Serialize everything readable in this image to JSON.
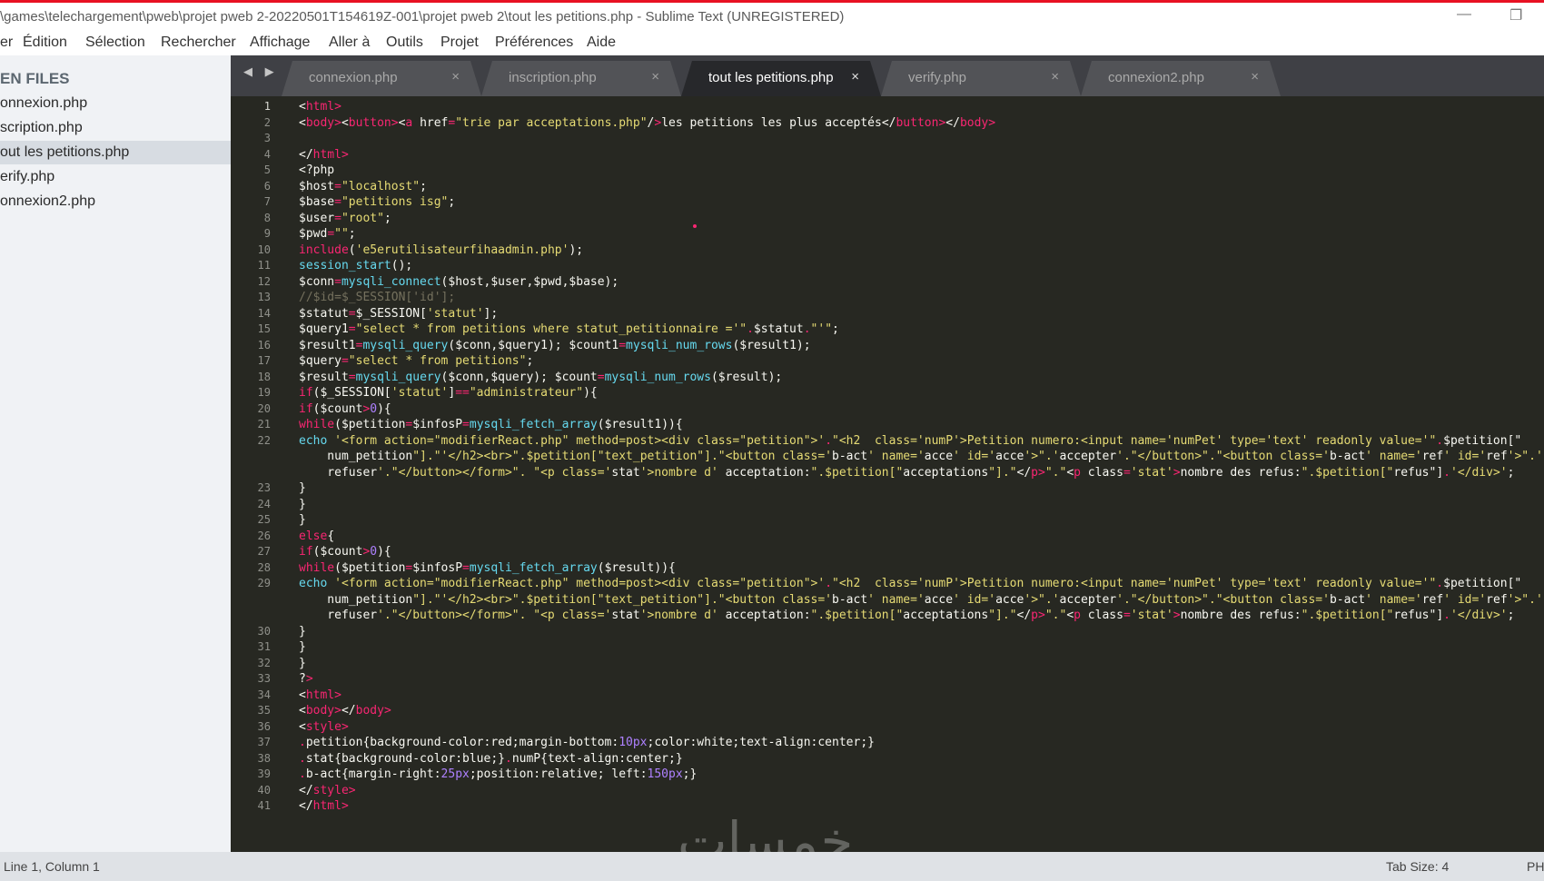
{
  "window": {
    "title": "\\games\\telechargement\\pweb\\projet pweb 2-20220501T154619Z-001\\projet pweb 2\\tout les petitions.php - Sublime Text (UNREGISTERED)",
    "minimize_glyph": "—",
    "maximize_glyph": "❐"
  },
  "menu": [
    {
      "id": "fichier",
      "label": "er"
    },
    {
      "id": "edition",
      "label": "Édition"
    },
    {
      "id": "selection",
      "label": "Sélection"
    },
    {
      "id": "rechercher",
      "label": "Rechercher"
    },
    {
      "id": "affichage",
      "label": "Affichage"
    },
    {
      "id": "allera",
      "label": "Aller à"
    },
    {
      "id": "outils",
      "label": "Outils"
    },
    {
      "id": "projet",
      "label": "Projet"
    },
    {
      "id": "preferences",
      "label": "Préférences"
    },
    {
      "id": "aide",
      "label": "Aide"
    }
  ],
  "sidebar": {
    "header": "EN FILES",
    "items": [
      {
        "label": "onnexion.php"
      },
      {
        "label": "scription.php"
      },
      {
        "label": "out les petitions.php"
      },
      {
        "label": "erify.php"
      },
      {
        "label": "onnexion2.php"
      }
    ]
  },
  "tabs": {
    "nav_arrows": "◀ ▶",
    "close_glyph": "×",
    "items": [
      {
        "label": "connexion.php"
      },
      {
        "label": "inscription.php"
      },
      {
        "label": "tout les petitions.php"
      },
      {
        "label": "verify.php"
      },
      {
        "label": "connexion2.php"
      }
    ]
  },
  "editor": {
    "colors": {
      "background": "#272822",
      "tag": "#f92672",
      "attribute": "#a6e22e",
      "string": "#e6db74",
      "function": "#66d9ef",
      "number": "#ae81ff",
      "comment": "#75715e",
      "text": "#f8f8f2"
    },
    "line_numbers": [
      "1",
      "2",
      "3",
      "4",
      "5",
      "6",
      "7",
      "8",
      "9",
      "10",
      "11",
      "12",
      "13",
      "14",
      "15",
      "16",
      "17",
      "18",
      "19",
      "20",
      "21",
      "22",
      "",
      "",
      "23",
      "24",
      "25",
      "26",
      "27",
      "28",
      "29",
      "",
      "",
      "30",
      "31",
      "32",
      "33",
      "34",
      "35",
      "36",
      "37",
      "38",
      "39",
      "40",
      "41"
    ],
    "lines": [
      "<html>",
      "<body><button><a href=\"trie par acceptations.php\"/>les petitions les plus acceptés</button></body>",
      "",
      "</html>",
      "<?php",
      "$host=\"localhost\";",
      "$base=\"petitions isg\";",
      "$user=\"root\";",
      "$pwd=\"\";",
      "include('e5erutilisateurfihaadmin.php');",
      "session_start();",
      "$conn=mysqli_connect($host,$user,$pwd,$base);",
      "//$id=$_SESSION['id'];",
      "$statut=$_SESSION['statut'];",
      "$query1=\"select * from petitions where statut_petitionnaire ='\".$statut.\"'\";",
      "$result1=mysqli_query($conn,$query1); $count1=mysqli_num_rows($result1);",
      "$query=\"select * from petitions\";",
      "$result=mysqli_query($conn,$query); $count=mysqli_num_rows($result);",
      "if($_SESSION['statut']==\"administrateur\"){",
      "if($count>0){",
      "while($petition=$infosP=mysqli_fetch_array($result1)){",
      "echo '<form action=\"modifierReact.php\" method=post><div class=\"petition\">'.\"<h2  class='numP'>Petition numero:<input name='numPet' type='text' readonly value='\".$petition[\"",
      "    num_petition\"].\"'</h2><br>\".$petition[\"text_petition\"].\"<button class='b-act' name='acce' id='acce'>\".'accepter'.\"</button>\".\"<button class='b-act' name='ref' id='ref'>\".'",
      "    refuser'.\"</button></form>\". \"<p class='stat'>nombre d' acceptation:\".$petition[\"acceptations\"].\"</p>\".\"<p class='stat'>nombre des refus:\".$petition[\"refus\"].'</div>';",
      "}",
      "}",
      "}",
      "else{",
      "if($count>0){",
      "while($petition=$infosP=mysqli_fetch_array($result)){",
      "echo '<form action=\"modifierReact.php\" method=post><div class=\"petition\">'.\"<h2  class='numP'>Petition numero:<input name='numPet' type='text' readonly value='\".$petition[\"",
      "    num_petition\"].\"'</h2><br>\".$petition[\"text_petition\"].\"<button class='b-act' name='acce' id='acce'>\".'accepter'.\"</button>\".\"<button class='b-act' name='ref' id='ref'>\".'",
      "    refuser'.\"</button></form>\". \"<p class='stat'>nombre d' acceptation:\".$petition[\"acceptations\"].\"</p>\".\"<p class='stat'>nombre des refus:\".$petition[\"refus\"].'</div>';",
      "}",
      "}",
      "}",
      "?>",
      "<html>",
      "<body></body>",
      "<style>",
      ".petition{background-color:red;margin-bottom:10px;color:white;text-align:center;}",
      ".stat{background-color:blue;}.numP{text-align:center;}",
      ".b-act{margin-right:25px;position:relative; left:150px;}",
      "</style>",
      "</html>"
    ]
  },
  "watermark": "خمسات",
  "status": {
    "position": "Line 1, Column 1",
    "tab_size": "Tab Size: 4",
    "syntax": "PHP"
  }
}
